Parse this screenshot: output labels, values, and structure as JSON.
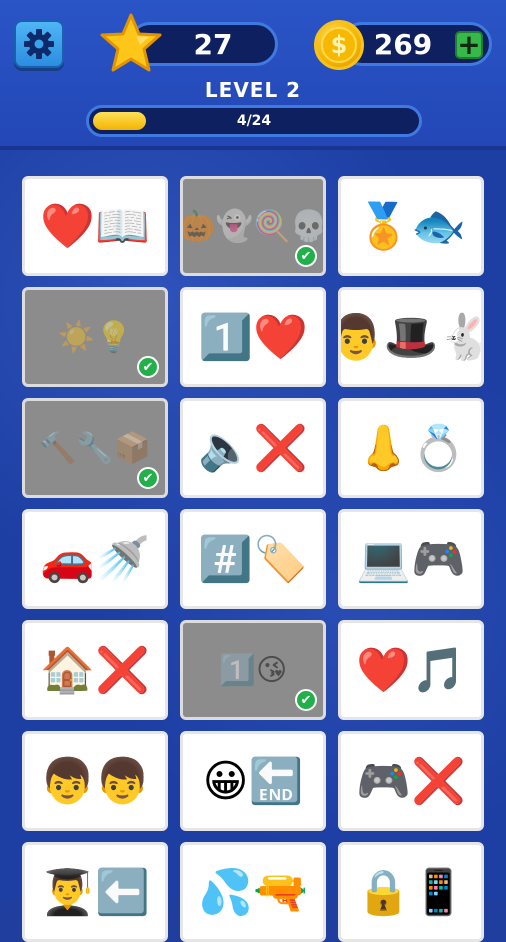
{
  "header": {
    "stars": "27",
    "coins": "269",
    "level": "LEVEL 2",
    "progress_text": "4/24",
    "progress_fraction": 0.167
  },
  "colors": {
    "accent": "#f2b400",
    "success": "#22b04b",
    "background": "#1d3fa4"
  },
  "icons": {
    "settings": "gear-icon",
    "star": "star-icon",
    "coin": "coin-icon",
    "plus": "plus-icon",
    "check": "check-icon"
  },
  "puzzles": [
    {
      "emojis": "❤️📖",
      "solved": false
    },
    {
      "emojis": "🎃👻🍭💀",
      "solved": true
    },
    {
      "emojis": "🏅🐟",
      "solved": false
    },
    {
      "emojis": "☀️💡",
      "solved": true
    },
    {
      "emojis": "1️⃣❤️",
      "solved": false
    },
    {
      "emojis": "👨🎩🐇",
      "solved": false
    },
    {
      "emojis": "🔨🔧📦",
      "solved": true
    },
    {
      "emojis": "🔈❌",
      "solved": false
    },
    {
      "emojis": "👃💍",
      "solved": false
    },
    {
      "emojis": "🚗🚿",
      "solved": false
    },
    {
      "emojis": "#️⃣🏷️",
      "solved": false
    },
    {
      "emojis": "💻🎮",
      "solved": false
    },
    {
      "emojis": "🏠❌",
      "solved": false
    },
    {
      "emojis": "1️⃣😘",
      "solved": true
    },
    {
      "emojis": "❤️🎵",
      "solved": false
    },
    {
      "emojis": "👦👦",
      "solved": false
    },
    {
      "emojis": "😀🔚",
      "solved": false
    },
    {
      "emojis": "🎮❌",
      "solved": false
    },
    {
      "emojis": "👨‍🎓⬅️",
      "solved": false
    },
    {
      "emojis": "💦🔫",
      "solved": false
    },
    {
      "emojis": "🔒📱",
      "solved": false
    }
  ]
}
